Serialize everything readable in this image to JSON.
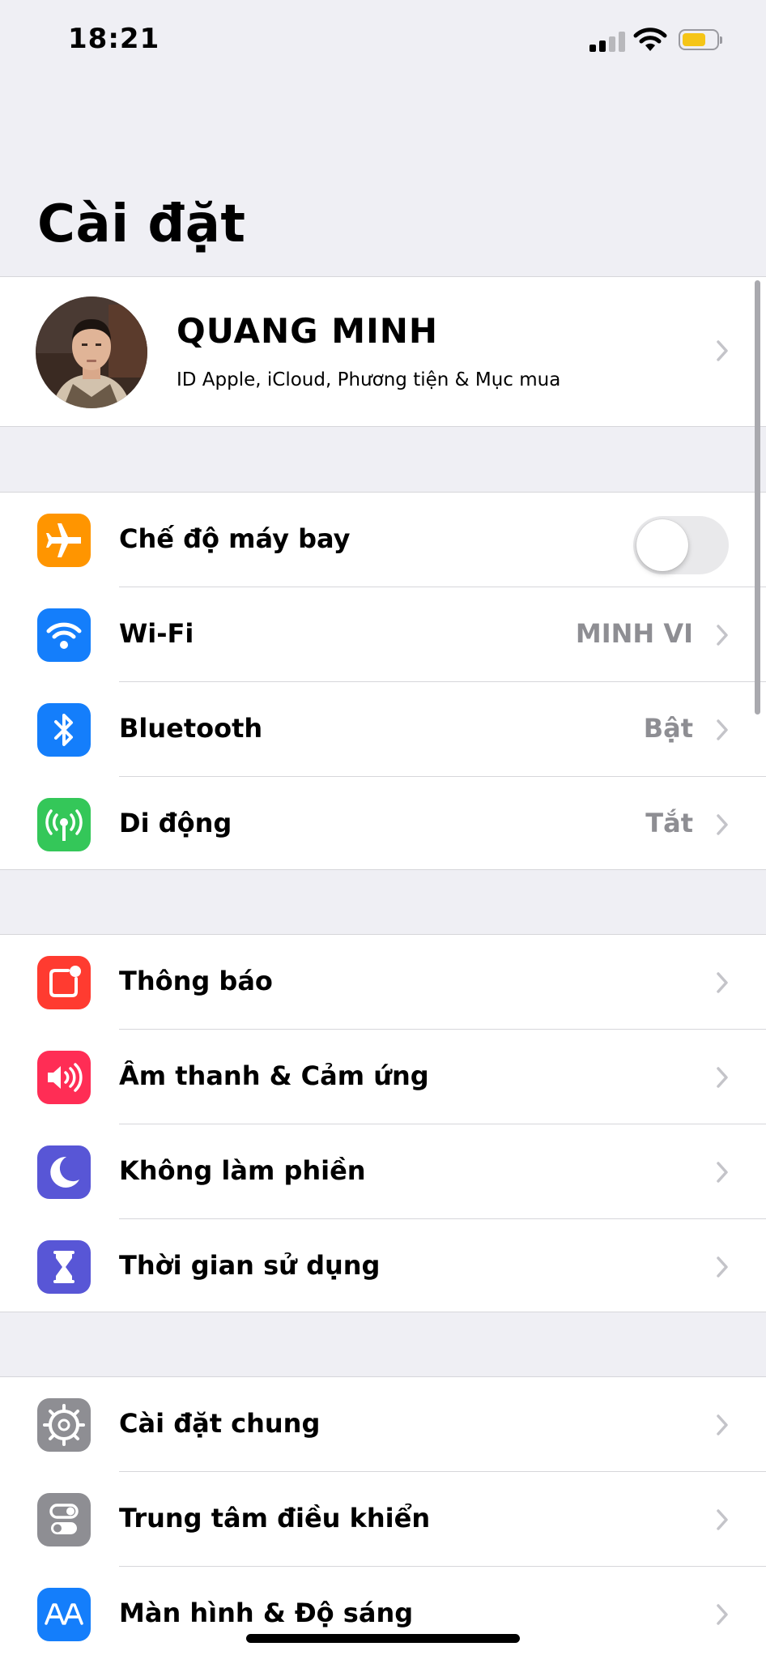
{
  "status_bar": {
    "time": "18:21",
    "battery_color": "#f5c518"
  },
  "header": {
    "title": "Cài đặt"
  },
  "profile": {
    "name": "QUANG MINH",
    "subtitle": "ID Apple, iCloud, Phương tiện & Mục mua"
  },
  "connectivity": {
    "airplane": {
      "label": "Chế độ máy bay",
      "enabled": false,
      "icon": "airplane-icon",
      "color": "#ff9500"
    },
    "wifi": {
      "label": "Wi-Fi",
      "value": "MINH VI",
      "icon": "wifi-icon",
      "color": "#147efb"
    },
    "bluetooth": {
      "label": "Bluetooth",
      "value": "Bật",
      "icon": "bluetooth-icon",
      "color": "#147efb"
    },
    "cellular": {
      "label": "Di động",
      "value": "Tắt",
      "icon": "cellular-antenna-icon",
      "color": "#34c759"
    }
  },
  "notifications_group": {
    "notifications": {
      "label": "Thông báo",
      "icon": "notifications-icon",
      "color": "#ff3b30"
    },
    "sounds": {
      "label": "Âm thanh & Cảm ứng",
      "icon": "speaker-icon",
      "color": "#ff2d55"
    },
    "dnd": {
      "label": "Không làm phiền",
      "icon": "moon-icon",
      "color": "#5856d6"
    },
    "screen_time": {
      "label": "Thời gian sử dụng",
      "icon": "hourglass-icon",
      "color": "#5856d6"
    }
  },
  "general_group": {
    "general": {
      "label": "Cài đặt chung",
      "icon": "gear-icon",
      "color": "#8e8e93"
    },
    "control_center": {
      "label": "Trung tâm điều khiển",
      "icon": "switches-icon",
      "color": "#8e8e93"
    },
    "display": {
      "label": "Màn hình & Độ sáng",
      "icon": "text-size-icon",
      "color": "#147efb"
    }
  }
}
